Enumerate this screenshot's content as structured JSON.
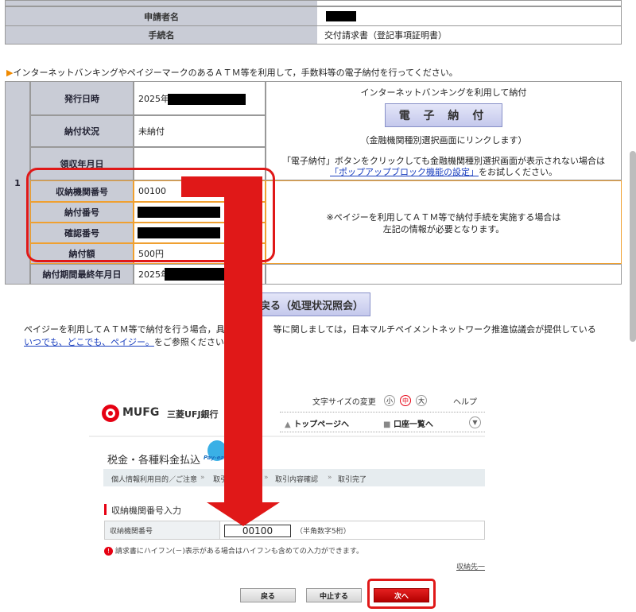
{
  "top_table": {
    "rows": [
      {
        "label": "申請者名",
        "value": ""
      },
      {
        "label": "手続名",
        "value": "交付請求書（登記事項証明書）"
      }
    ]
  },
  "notice": "インターネットバンキングやペイジーマークのあるＡＴＭ等を利用して，手数料等の電子納付を行ってください。",
  "payment_table": {
    "row_number": "1",
    "rows": [
      {
        "label": "発行日時",
        "value": "2025年"
      },
      {
        "label": "納付状況",
        "value": "未納付"
      },
      {
        "label": "領収年月日",
        "value": ""
      },
      {
        "label": "収納機関番号",
        "value": "00100"
      },
      {
        "label": "納付番号",
        "value": ""
      },
      {
        "label": "確認番号",
        "value": ""
      },
      {
        "label": "納付額",
        "value": "500円"
      },
      {
        "label": "納付期間最終年月日",
        "value": "2025年"
      }
    ],
    "ib_panel": {
      "title": "インターネットバンキングを利用して納付",
      "button": "電 子 納 付",
      "sub": "（金融機関種別選択画面にリンクします）",
      "note1": "「電子納付」ボタンをクリックしても金融機関種別選択画面が表示されない場合は",
      "note_link": "「ポップアップブロック機能の設定」",
      "note2": "をお試しください。"
    },
    "atm_panel": {
      "line1": "※ペイジーを利用してＡＴＭ等で納付手続を実施する場合は",
      "line2": "左記の情報が必要となります。"
    }
  },
  "back_button": "戻る（処理状況照会）",
  "pay_easy_text": {
    "before": "ペイジーを利用してＡＴＭ等で納付を行う場合，具体的な",
    "after": "等に関しましては，日本マルチペイメントネットワーク推進協議会が提供している",
    "link": "いつでも、どこでも、ペイジー。",
    "tail": "をご参照ください。"
  },
  "bank": {
    "logo_text": "MUFG",
    "bank_name": "三菱UFJ銀行",
    "font_size_label": "文字サイズの変更",
    "font_sizes": [
      "小",
      "中",
      "大"
    ],
    "help": "ヘルプ",
    "nav_home": "トップページへ",
    "nav_accounts": "口座一覧へ",
    "page_title": "税金・各種料金払込",
    "payeasy_logo": "Pay-easy",
    "steps": [
      "個人情報利用目的／ご注意",
      "取引内容入力",
      "取引内容確認",
      "取引完了"
    ],
    "section_title": "収納機関番号入力",
    "field_label": "収納機関番号",
    "field_value": "00100",
    "field_hint": "（半角数字5桁）",
    "warning": "請求書にハイフン(－)表示がある場合はハイフンも含めての入力ができます。",
    "payee_link": "収納先一",
    "btn_back": "戻る",
    "btn_cancel": "中止する",
    "btn_next": "次へ"
  },
  "colors": {
    "label_bg": "#c9ccd6",
    "highlight_red": "#e01818",
    "orange_border": "#f0a030",
    "next_button": "#cc0000"
  }
}
